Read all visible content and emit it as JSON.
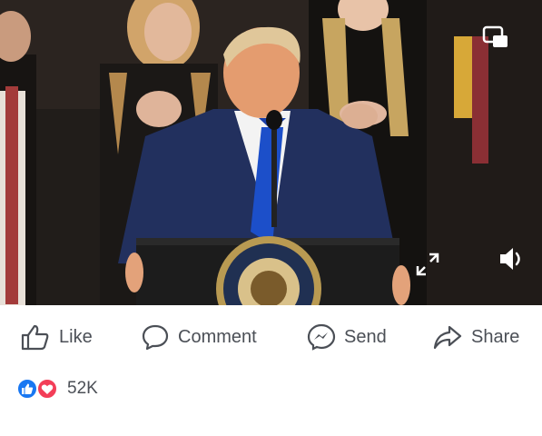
{
  "post": {
    "video": {
      "description_icon": "video-frame",
      "controls": {
        "pip_icon": "picture-in-picture-icon",
        "expand_icon": "expand-icon",
        "volume_icon": "volume-icon"
      }
    },
    "actions": {
      "like_label": "Like",
      "comment_label": "Comment",
      "send_label": "Send",
      "share_label": "Share"
    },
    "reactions": {
      "types": [
        "like",
        "love"
      ],
      "count": "52K"
    }
  },
  "colors": {
    "like_blue": "#1877f2",
    "love_red": "#f33e58",
    "text_gray": "#4b4f56",
    "suit_navy": "#1f2b55",
    "tie_blue": "#1c4fc9"
  }
}
